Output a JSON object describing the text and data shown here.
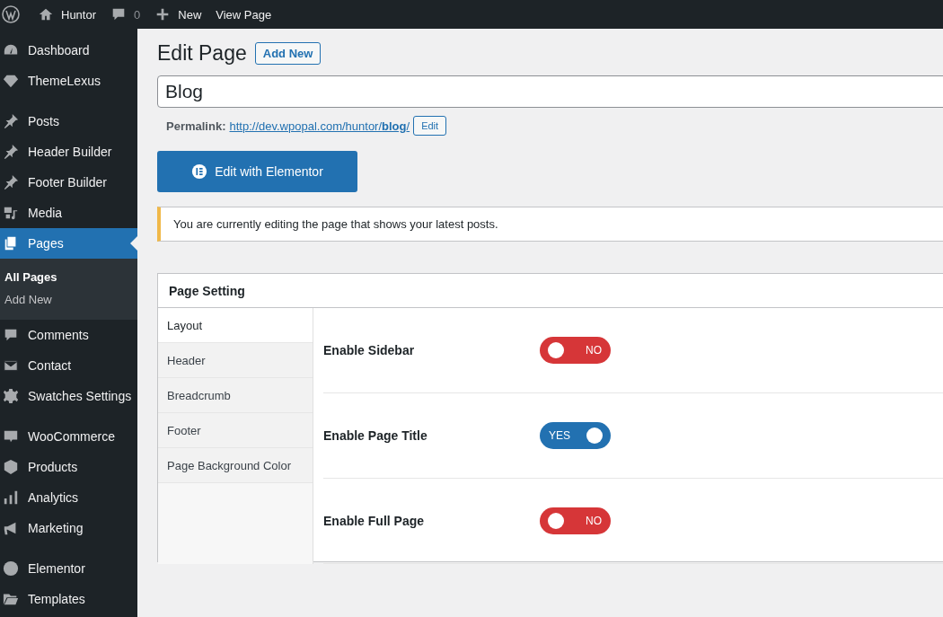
{
  "admin_bar": {
    "site_name": "Huntor",
    "comments_count": "0",
    "new_label": "New",
    "view_label": "View Page"
  },
  "sidebar": {
    "groups": [
      {
        "items": [
          {
            "label": "Dashboard",
            "selected": false
          },
          {
            "label": "ThemeLexus",
            "selected": false
          }
        ]
      },
      {
        "items": [
          {
            "label": "Posts",
            "selected": false
          },
          {
            "label": "Header Builder",
            "selected": false
          },
          {
            "label": "Footer Builder",
            "selected": false
          },
          {
            "label": "Media",
            "selected": false
          },
          {
            "label": "Pages",
            "selected": true,
            "children": [
              {
                "label": "All Pages",
                "selected": true
              },
              {
                "label": "Add New",
                "selected": false
              }
            ]
          },
          {
            "label": "Comments",
            "selected": false
          },
          {
            "label": "Contact",
            "selected": false
          },
          {
            "label": "Swatches Settings",
            "selected": false
          }
        ]
      },
      {
        "items": [
          {
            "label": "WooCommerce",
            "selected": false
          },
          {
            "label": "Products",
            "selected": false
          },
          {
            "label": "Analytics",
            "selected": false
          },
          {
            "label": "Marketing",
            "selected": false
          }
        ]
      },
      {
        "items": [
          {
            "label": "Elementor",
            "selected": false
          },
          {
            "label": "Templates",
            "selected": false
          }
        ]
      }
    ]
  },
  "heading": "Edit Page",
  "add_new": "Add New",
  "title_value": "Blog",
  "permalink": {
    "label": "Permalink:",
    "url": "http://dev.wpopal.com/huntor/**blog**/",
    "edit": "Edit"
  },
  "elementor_button": "Edit with Elementor",
  "notice": "You are currently editing the page that shows your latest posts.",
  "page_setting": {
    "title": "Page Setting",
    "tabs": [
      {
        "label": "Layout",
        "selected": true
      },
      {
        "label": "Header",
        "selected": false
      },
      {
        "label": "Breadcrumb",
        "selected": false
      },
      {
        "label": "Footer",
        "selected": false
      },
      {
        "label": "Page Background Color",
        "selected": false
      }
    ],
    "options": [
      {
        "label": "Enable Sidebar",
        "on": false,
        "state_label": "NO"
      },
      {
        "label": "Enable Page Title",
        "on": true,
        "state_label": "YES"
      },
      {
        "label": "Enable Full Page",
        "on": false,
        "state_label": "NO"
      }
    ]
  }
}
